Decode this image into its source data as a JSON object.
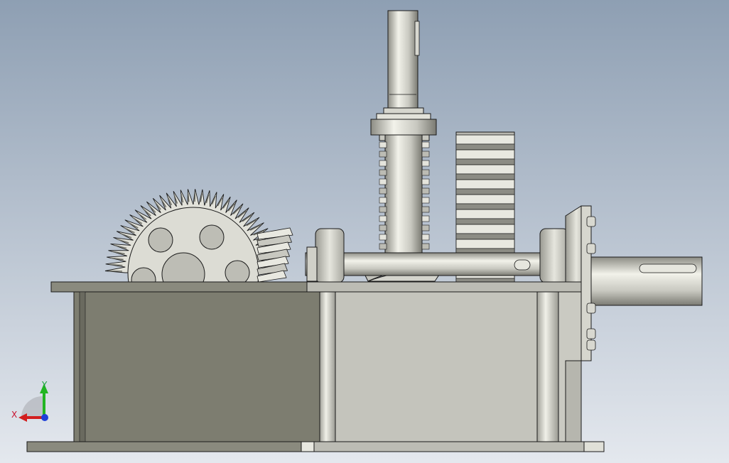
{
  "viewport": {
    "background_top": "#8e9fb3",
    "background_bottom": "#e4e8ee"
  },
  "model": {
    "housing_dark": "#7d7d70",
    "housing_light": "#c4c4bc",
    "metal": "#cfcfc6",
    "metal_shadow": "#8c8c84",
    "outline": "#1a1a1a"
  },
  "triad": {
    "x_label": "X",
    "y_label": "Y",
    "x_color": "#d21e1e",
    "y_color": "#22b522",
    "z_color": "#1f3fd8"
  }
}
